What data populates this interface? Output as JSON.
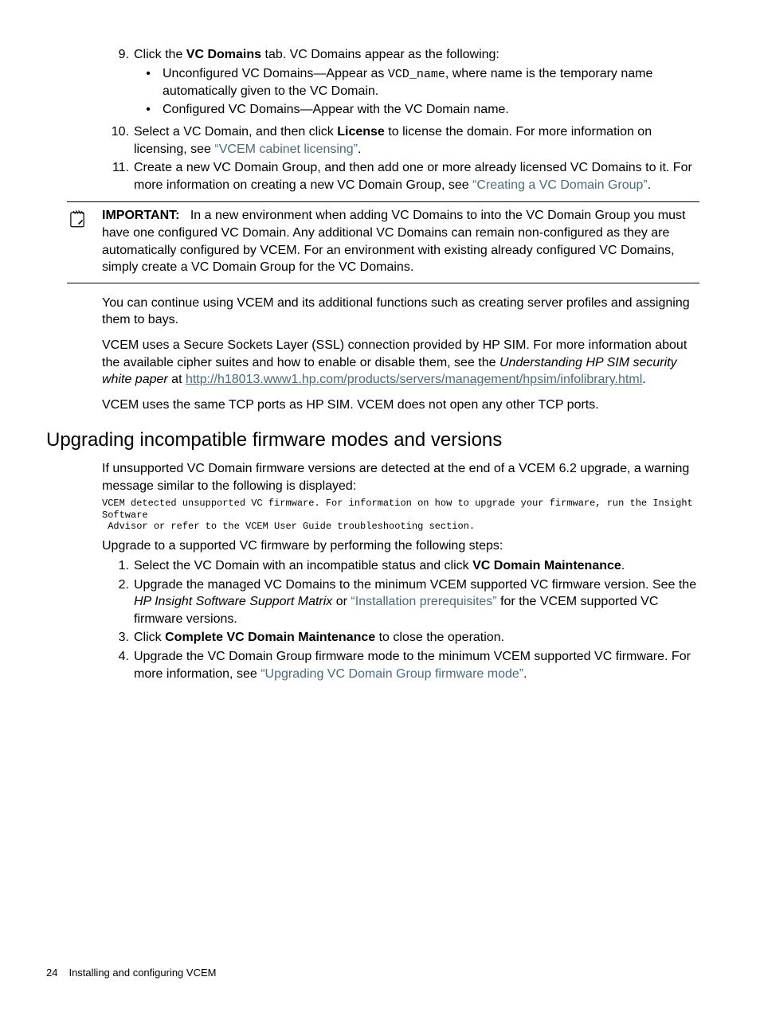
{
  "ol_start": {
    "item9": {
      "num": "9.",
      "pre": "Click the ",
      "bold": "VC Domains",
      "post": " tab. VC Domains appear as the following:",
      "sub": [
        {
          "pre": "Unconfigured VC Domains—Appear as ",
          "code": "VCD_name",
          "post": ", where name is the temporary name automatically given to the VC Domain."
        },
        {
          "text": "Configured VC Domains—Appear with the VC Domain name."
        }
      ]
    },
    "item10": {
      "num": "10.",
      "pre": "Select a VC Domain, and then click ",
      "bold": "License",
      "mid": " to license the domain. For more information on licensing, see ",
      "link": "“VCEM cabinet licensing”",
      "post": "."
    },
    "item11": {
      "num": "11.",
      "pre": "Create a new VC Domain Group, and then add one or more already licensed VC Domains to it. For more information on creating a new VC Domain Group, see ",
      "link": "“Creating a VC Domain Group”",
      "post": "."
    }
  },
  "important": {
    "label": "IMPORTANT:",
    "body": "In a new environment when adding VC Domains to into the VC Domain Group you must have one configured VC Domain. Any additional VC Domains can remain non-configured as they are automatically configured by VCEM. For an environment with existing already configured VC Domains, simply create a VC Domain Group for the VC Domains."
  },
  "para1": "You can continue using VCEM and its additional functions such as creating server profiles and assigning them to bays.",
  "para2": {
    "a": "VCEM uses a Secure Sockets Layer (SSL) connection provided by HP SIM. For more information about the available cipher suites and how to enable or disable them, see the ",
    "italic": "Understanding HP SIM security white paper",
    "b": " at ",
    "url": "http://h18013.www1.hp.com/products/servers/management/hpsim/infolibrary.html",
    "c": "."
  },
  "para3": "VCEM uses the same TCP ports as HP SIM. VCEM does not open any other TCP ports.",
  "heading": "Upgrading incompatible firmware modes and versions",
  "para4": "If unsupported VC Domain firmware versions are detected at the end of a VCEM 6.2 upgrade, a warning message similar to the following is displayed:",
  "code": "VCEM detected unsupported VC firmware. For information on how to upgrade your firmware, run the Insight Software\n Advisor or refer to the VCEM User Guide troubleshooting section.",
  "para5": "Upgrade to a supported VC firmware by performing the following steps:",
  "ol2": {
    "i1": {
      "num": "1.",
      "pre": "Select the VC Domain with an incompatible status and click ",
      "bold": "VC Domain Maintenance",
      "post": "."
    },
    "i2": {
      "num": "2.",
      "pre": "Upgrade the managed VC Domains to the minimum VCEM supported VC firmware version. See the ",
      "italic": "HP Insight Software Support Matrix",
      "mid": " or ",
      "link": "“Installation prerequisites”",
      "post": " for the VCEM supported VC firmware versions."
    },
    "i3": {
      "num": "3.",
      "pre": "Click ",
      "bold": "Complete VC Domain Maintenance",
      "post": " to close the operation."
    },
    "i4": {
      "num": "4.",
      "pre": "Upgrade the VC Domain Group firmware mode to the minimum VCEM supported VC firmware. For more information, see ",
      "link": "“Upgrading VC Domain Group firmware mode”",
      "post": "."
    }
  },
  "footer": {
    "page": "24",
    "title": "Installing and configuring VCEM"
  }
}
